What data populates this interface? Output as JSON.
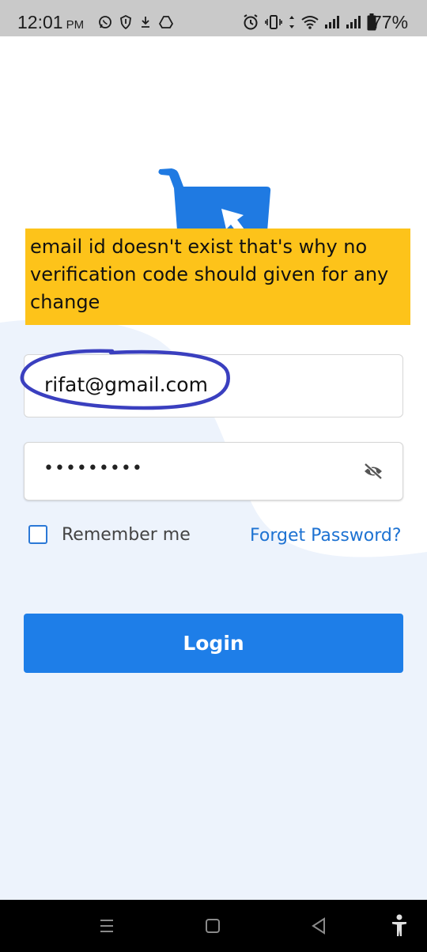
{
  "status_bar": {
    "time": "12:01",
    "ampm": "PM",
    "battery": "77%",
    "left_icons": [
      "whatsapp-icon",
      "shield-icon",
      "download-icon",
      "drive-icon"
    ],
    "right_icons": [
      "alarm-icon",
      "vibrate-icon",
      "data-arrows-icon",
      "wifi-icon",
      "signal-icon",
      "signal-icon",
      "battery-icon"
    ]
  },
  "annotation": {
    "text": "email id doesn't exist that's why no verification code should given for any change"
  },
  "login_form": {
    "email_value": "rifat@gmail.com",
    "password_value": "•••••••••",
    "remember_label": "Remember me",
    "forgot_label": "Forget Password?",
    "login_label": "Login"
  },
  "colors": {
    "primary": "#1e7ee8",
    "link": "#1d72d2",
    "annotation_bg": "#fdc31a",
    "ink": "#3a3fbf",
    "page_bg_wave": "#edf3fc"
  },
  "nav_bar": {
    "icons": [
      "recents-icon",
      "home-icon",
      "back-icon",
      "accessibility-icon"
    ]
  }
}
